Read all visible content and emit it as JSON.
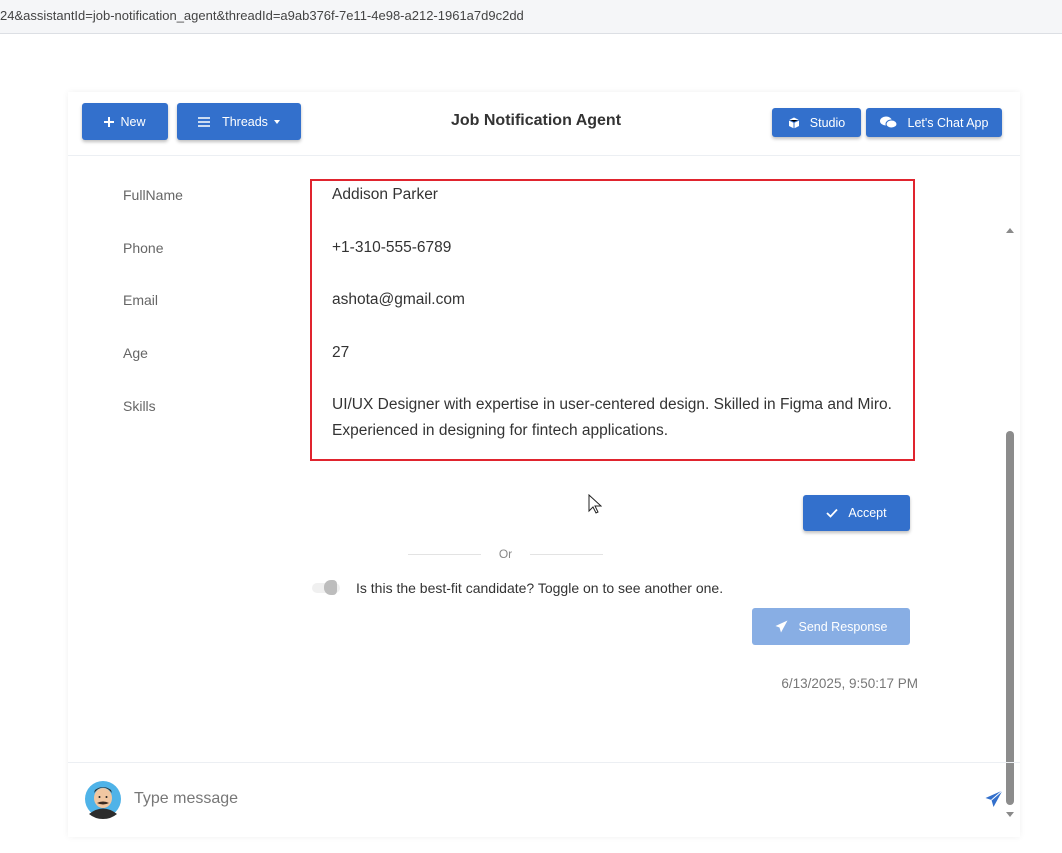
{
  "browser": {
    "url": "24&assistantId=job-notification_agent&threadId=a9ab376f-7e11-4e98-a212-1961a7d9c2dd"
  },
  "header": {
    "new_label": "New",
    "threads_label": "Threads",
    "title": "Job Notification Agent",
    "studio_label": "Studio",
    "chat_app_label": "Let's Chat App"
  },
  "candidate": {
    "fields": [
      {
        "label": "FullName",
        "value": "Addison Parker"
      },
      {
        "label": "Phone",
        "value": "+1-310-555-6789"
      },
      {
        "label": "Email",
        "value": "ashota@gmail.com"
      },
      {
        "label": "Age",
        "value": "27"
      },
      {
        "label": "Skills",
        "value": "UI/UX Designer with expertise in user-centered design. Skilled in Figma and Miro. Experienced in designing for fintech applications."
      }
    ]
  },
  "actions": {
    "accept_label": "Accept",
    "or_label": "Or",
    "toggle_label": "Is this the best-fit candidate? Toggle on to see another one.",
    "send_response_label": "Send Response",
    "timestamp": "6/13/2025, 9:50:17 PM"
  },
  "composer": {
    "placeholder": "Type message"
  },
  "colors": {
    "primary": "#3370cc",
    "primary_disabled": "#88aee4",
    "highlight_border": "#e0242e"
  }
}
